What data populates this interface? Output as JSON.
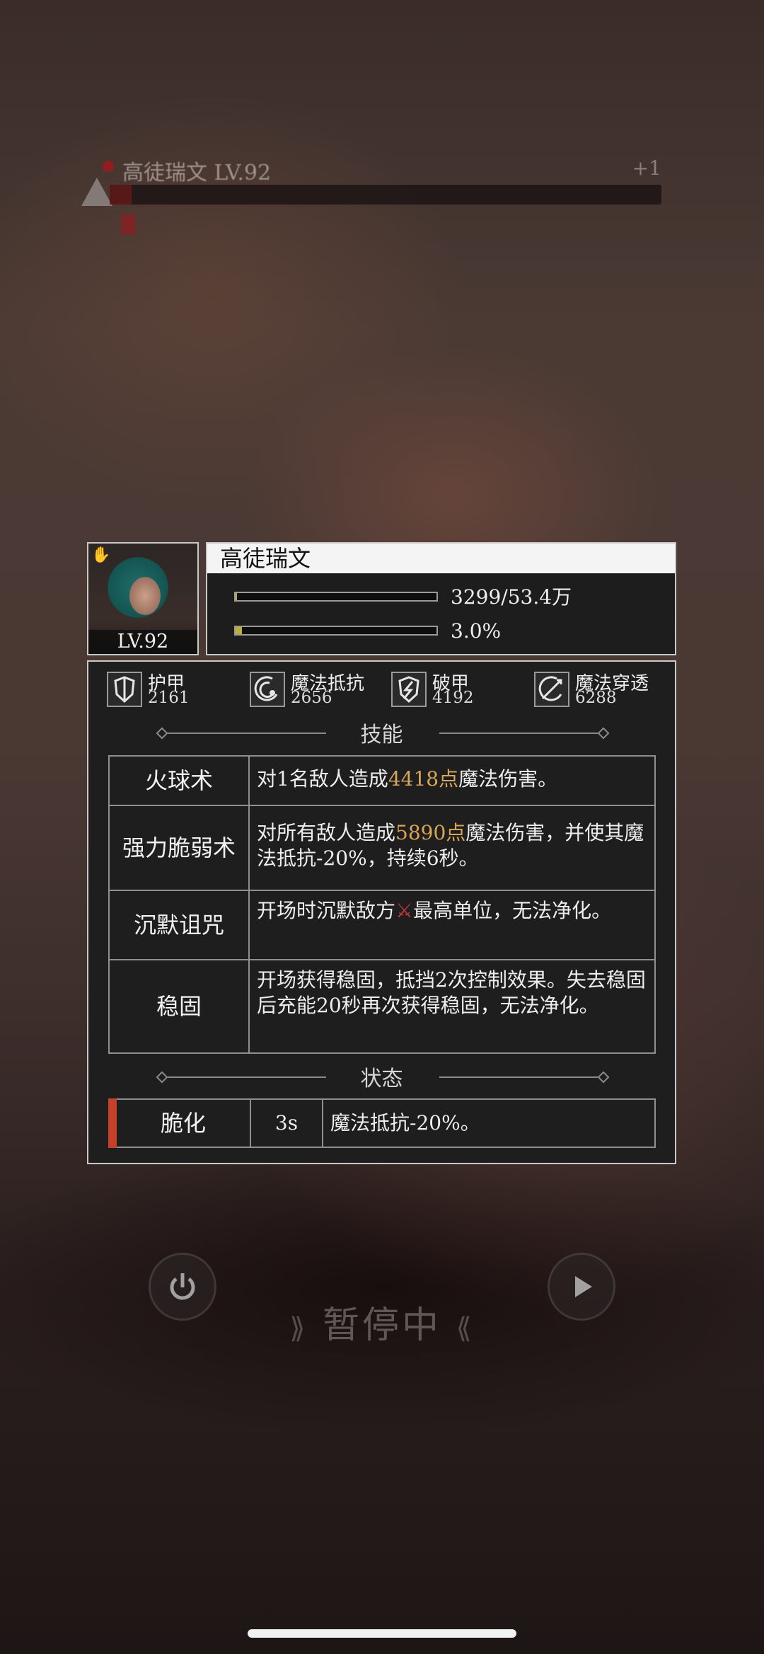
{
  "boss": {
    "name": "高徒瑞文 LV.92",
    "end_label": "+1",
    "hp_fraction": 0.04
  },
  "hero": {
    "name": "高徒瑞文",
    "level": "LV.92",
    "hp_text": "3299/53.4万",
    "hp_fraction": 0.006,
    "energy_text": "3.0%",
    "energy_fraction": 0.03
  },
  "attributes": [
    {
      "label": "护甲",
      "value": "2161",
      "icon": "armor-icon"
    },
    {
      "label": "魔法抵抗",
      "value": "2656",
      "icon": "magic-resist-icon"
    },
    {
      "label": "破甲",
      "value": "4192",
      "icon": "armor-break-icon"
    },
    {
      "label": "魔法穿透",
      "value": "6288",
      "icon": "magic-penetration-icon"
    }
  ],
  "sections": {
    "skills_title": "技能",
    "status_title": "状态"
  },
  "skills": [
    {
      "name": "火球术",
      "desc_pre": "对1名敌人造成",
      "desc_hl": "4418点",
      "desc_post": "魔法伤害。"
    },
    {
      "name": "强力脆弱术",
      "desc_pre": "对所有敌人造成",
      "desc_hl": "5890点",
      "desc_post": "魔法伤害，并使其魔法抵抗-20%，持续6秒。"
    },
    {
      "name": "沉默诅咒",
      "desc_pre": "开场时沉默敌方",
      "desc_mark": "⚔",
      "desc_post": "最高单位，无法净化。"
    },
    {
      "name": "稳固",
      "desc": "开场获得稳固，抵挡2次控制效果。失去稳固后充能20秒再次获得稳固，无法净化。"
    }
  ],
  "status": {
    "name": "脆化",
    "time": "3s",
    "desc": "魔法抵抗-20%。"
  },
  "controls": {
    "pause_label": "暂停中",
    "power_icon": "power-icon",
    "play_icon": "play-icon"
  },
  "colors": {
    "highlight": "#d9a659",
    "status_accent": "#c6402a"
  }
}
